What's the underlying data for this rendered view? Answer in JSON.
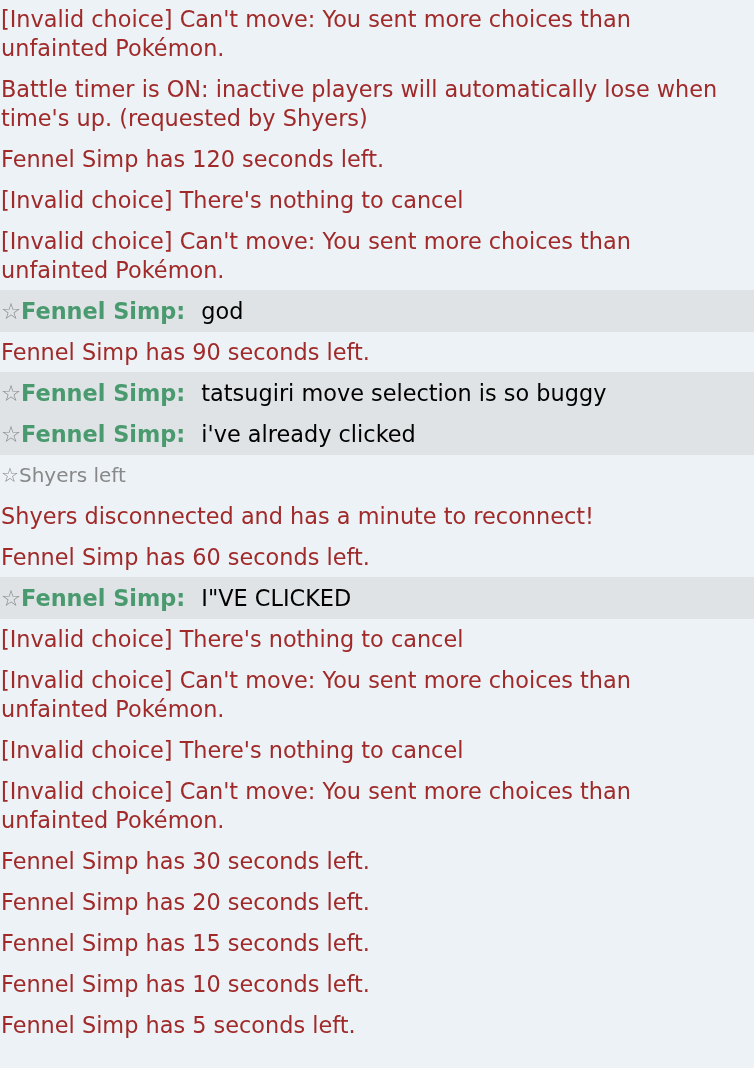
{
  "messages": [
    {
      "kind": "notice",
      "text": "[Invalid choice] Can't move: You sent more choices than unfainted Pokémon."
    },
    {
      "kind": "notice",
      "text": "Battle timer is ON: inactive players will automatically lose when time's up. (requested by Shyers)"
    },
    {
      "kind": "notice",
      "text": "Fennel Simp has 120 seconds left."
    },
    {
      "kind": "notice",
      "text": "[Invalid choice] There's nothing to cancel"
    },
    {
      "kind": "notice",
      "text": "[Invalid choice] Can't move: You sent more choices than unfainted Pokémon."
    },
    {
      "kind": "chat",
      "rank": "☆",
      "user": "Fennel Simp:",
      "text": "god"
    },
    {
      "kind": "notice",
      "text": "Fennel Simp has 90 seconds left."
    },
    {
      "kind": "chat",
      "rank": "☆",
      "user": "Fennel Simp:",
      "text": "tatsugiri move selection is so buggy"
    },
    {
      "kind": "chat",
      "rank": "☆",
      "user": "Fennel Simp:",
      "text": "i've already clicked"
    },
    {
      "kind": "presence",
      "rank": "☆",
      "text": "Shyers left"
    },
    {
      "kind": "notice",
      "text": "Shyers disconnected and has a minute to reconnect!"
    },
    {
      "kind": "notice",
      "text": "Fennel Simp has 60 seconds left."
    },
    {
      "kind": "chat",
      "rank": "☆",
      "user": "Fennel Simp:",
      "text": "I\"VE CLICKED"
    },
    {
      "kind": "notice",
      "text": "[Invalid choice] There's nothing to cancel"
    },
    {
      "kind": "notice",
      "text": "[Invalid choice] Can't move: You sent more choices than unfainted Pokémon."
    },
    {
      "kind": "notice",
      "text": "[Invalid choice] There's nothing to cancel"
    },
    {
      "kind": "notice",
      "text": "[Invalid choice] Can't move: You sent more choices than unfainted Pokémon."
    },
    {
      "kind": "notice",
      "text": "Fennel Simp has 30 seconds left."
    },
    {
      "kind": "notice",
      "text": "Fennel Simp has 20 seconds left."
    },
    {
      "kind": "notice",
      "text": "Fennel Simp has 15 seconds left."
    },
    {
      "kind": "notice",
      "text": "Fennel Simp has 10 seconds left."
    },
    {
      "kind": "notice",
      "text": "Fennel Simp has 5 seconds left."
    }
  ]
}
